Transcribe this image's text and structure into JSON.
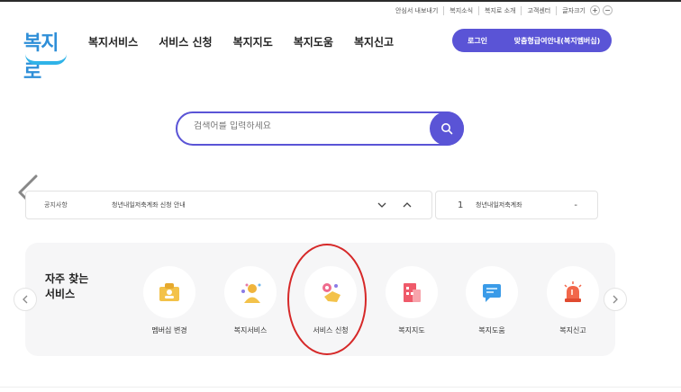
{
  "utility": {
    "items": [
      "안심서 내보내기",
      "복지소식",
      "복지로 소개",
      "고객센터",
      "글자크기"
    ],
    "font_plus": "+",
    "font_minus": "−"
  },
  "logo": {
    "text": "복지로"
  },
  "gnb": {
    "items": [
      "복지서비스",
      "서비스 신청",
      "복지지도",
      "복지도움",
      "복지신고"
    ]
  },
  "login": {
    "login_label": "로그인",
    "member_label": "맞춤형급여안내(복지멤버십)"
  },
  "search": {
    "placeholder": "검색어를 입력하세요"
  },
  "notice": {
    "label": "공지사항",
    "text": "청년내일저축계좌 신청 안내",
    "rank_number": "1",
    "rank_text": "청년내일저축계좌",
    "rank_change": "-"
  },
  "frequent": {
    "title_line1": "자주 찾는",
    "title_line2": "서비스",
    "services": [
      {
        "name": "멤버십 변경",
        "icon": "membership-icon"
      },
      {
        "name": "복지서비스",
        "icon": "people-icon"
      },
      {
        "name": "서비스 신청",
        "icon": "hand-apply-icon"
      },
      {
        "name": "복지지도",
        "icon": "building-icon"
      },
      {
        "name": "복지도움",
        "icon": "chat-icon"
      },
      {
        "name": "복지신고",
        "icon": "siren-icon"
      }
    ]
  },
  "colors": {
    "accent": "#5a54d6",
    "highlight": "#d62828",
    "logo": "#2f8fd8"
  }
}
